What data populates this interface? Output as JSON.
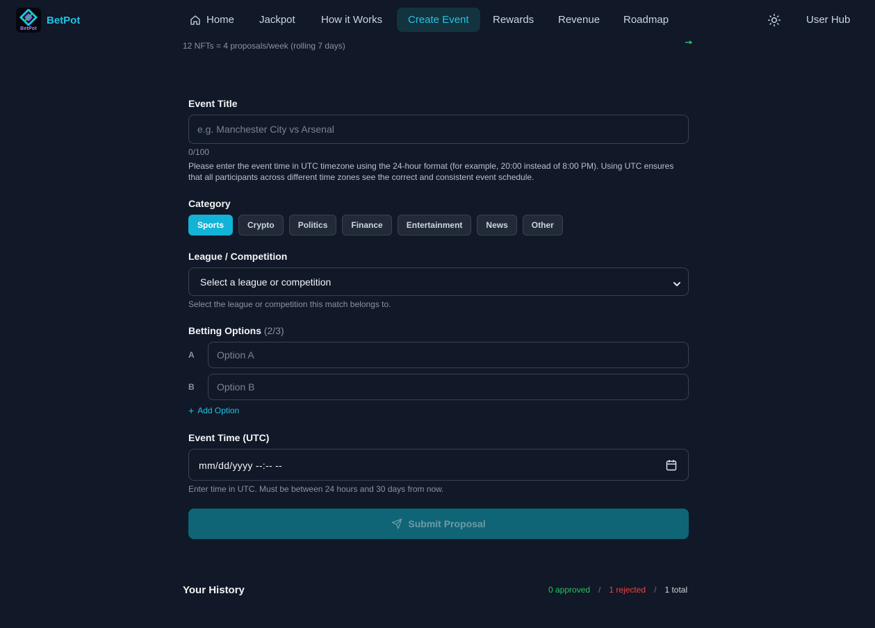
{
  "brand": {
    "name": "BetPot",
    "logo_text": "BetPot"
  },
  "nav": {
    "items": [
      {
        "label": "Home"
      },
      {
        "label": "Jackpot"
      },
      {
        "label": "How it Works"
      },
      {
        "label": "Create Event"
      },
      {
        "label": "Rewards"
      },
      {
        "label": "Revenue"
      },
      {
        "label": "Roadmap"
      }
    ],
    "active": "Create Event",
    "user_hub": "User Hub"
  },
  "nft_note": "12 NFTs = 4 proposals/week (rolling 7 days)",
  "form": {
    "title": {
      "label": "Event Title",
      "placeholder": "e.g. Manchester City vs Arsenal",
      "value": "",
      "counter": "0/100",
      "hint": "Please enter the event time in UTC timezone using the 24-hour format (for example, 20:00 instead of 8:00 PM). Using UTC ensures that all participants across different time zones see the correct and consistent event schedule."
    },
    "category": {
      "label": "Category",
      "options": [
        "Sports",
        "Crypto",
        "Politics",
        "Finance",
        "Entertainment",
        "News",
        "Other"
      ],
      "selected": "Sports"
    },
    "league": {
      "label": "League / Competition",
      "selected": "Select a league or competition",
      "hint": "Select the league or competition this match belongs to."
    },
    "betting": {
      "label": "Betting Options",
      "count": "(2/3)",
      "options": [
        {
          "letter": "A",
          "placeholder": "Option A",
          "value": ""
        },
        {
          "letter": "B",
          "placeholder": "Option B",
          "value": ""
        }
      ],
      "add_label": "Add Option"
    },
    "event_time": {
      "label": "Event Time (UTC)",
      "value": "mm/dd/yyyy --:-- --",
      "hint": "Enter time in UTC. Must be between 24 hours and 30 days from now."
    },
    "submit_label": "Submit Proposal"
  },
  "history": {
    "title": "Your History",
    "approved": "0 approved",
    "rejected": "1 rejected",
    "total": "1 total",
    "separator": "/"
  },
  "colors": {
    "accent": "#22c3e6",
    "background": "#111827",
    "approved": "#22c55e",
    "rejected": "#ef4444"
  }
}
